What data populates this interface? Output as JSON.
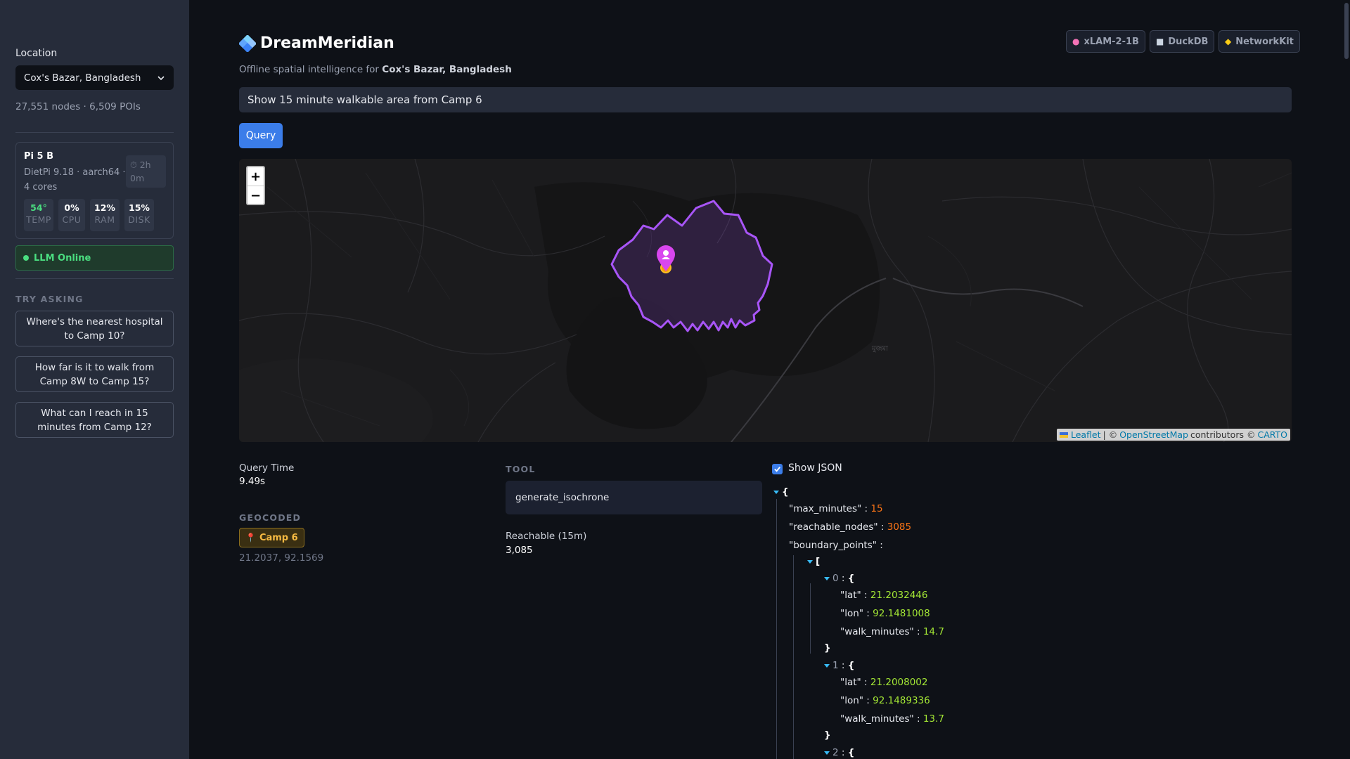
{
  "sidebar": {
    "location_label": "Location",
    "location_value": "Cox's Bazar, Bangladesh",
    "stats": "27,551 nodes · 6,509 POIs",
    "device": {
      "name": "Pi 5 B",
      "os": "DietPi 9.18 · aarch64 ·",
      "cores": "4 cores",
      "uptime_h": "⏱ 2h",
      "uptime_m": "0m",
      "metrics": [
        {
          "value": "54°",
          "label": "TEMP",
          "color": "#4ade80"
        },
        {
          "value": "0%",
          "label": "CPU",
          "color": "#ffffff"
        },
        {
          "value": "12%",
          "label": "RAM",
          "color": "#ffffff"
        },
        {
          "value": "15%",
          "label": "DISK",
          "color": "#ffffff"
        }
      ]
    },
    "llm_status": "LLM Online",
    "try_heading": "TRY ASKING",
    "suggestions": [
      "Where's the nearest hospital to Camp 10?",
      "How far is it to walk from Camp 8W to Camp 15?",
      "What can I reach in 15 minutes from Camp 12?"
    ]
  },
  "header": {
    "title": "DreamMeridian",
    "subtitle_prefix": "Offline spatial intelligence for",
    "subtitle_location": "Cox's Bazar, Bangladesh",
    "badges": [
      {
        "icon": "brain-icon",
        "label": "xLAM-2-1B"
      },
      {
        "icon": "database-icon",
        "label": "DuckDB"
      },
      {
        "icon": "network-icon",
        "label": "NetworkKit"
      }
    ]
  },
  "query": {
    "value": "Show 15 minute walkable area from Camp 6",
    "button": "Query"
  },
  "map": {
    "zoom_in": "+",
    "zoom_out": "−",
    "attribution": {
      "leaflet": "Leaflet",
      "sep": "| ©",
      "osm": "OpenStreetMap",
      "contrib": "contributors ©",
      "carto": "CARTO"
    },
    "isochrone_color": "#a855f7",
    "place_label": "মুজমা"
  },
  "results": {
    "query_time_label": "Query Time",
    "query_time_value": "9.49s",
    "geocoded_heading": "GEOCODED",
    "geocoded_place": "Camp 6",
    "geocoded_coords": "21.2037, 92.1569",
    "tool_heading": "TOOL",
    "tool_value": "generate_isochrone",
    "reachable_label": "Reachable (15m)",
    "reachable_value": "3,085"
  },
  "json_view": {
    "toggle_label": "Show JSON",
    "max_minutes_key": "\"max_minutes\"",
    "max_minutes": "15",
    "reachable_nodes_key": "\"reachable_nodes\"",
    "reachable_nodes": "3085",
    "boundary_key": "\"boundary_points\"",
    "lat_key": "\"lat\"",
    "lon_key": "\"lon\"",
    "walk_key": "\"walk_minutes\"",
    "points": [
      {
        "index": "0",
        "lat": "21.2032446",
        "lon": "92.1481008",
        "walk": "14.7"
      },
      {
        "index": "1",
        "lat": "21.2008002",
        "lon": "92.1489336",
        "walk": "13.7"
      },
      {
        "index": "2"
      }
    ]
  }
}
